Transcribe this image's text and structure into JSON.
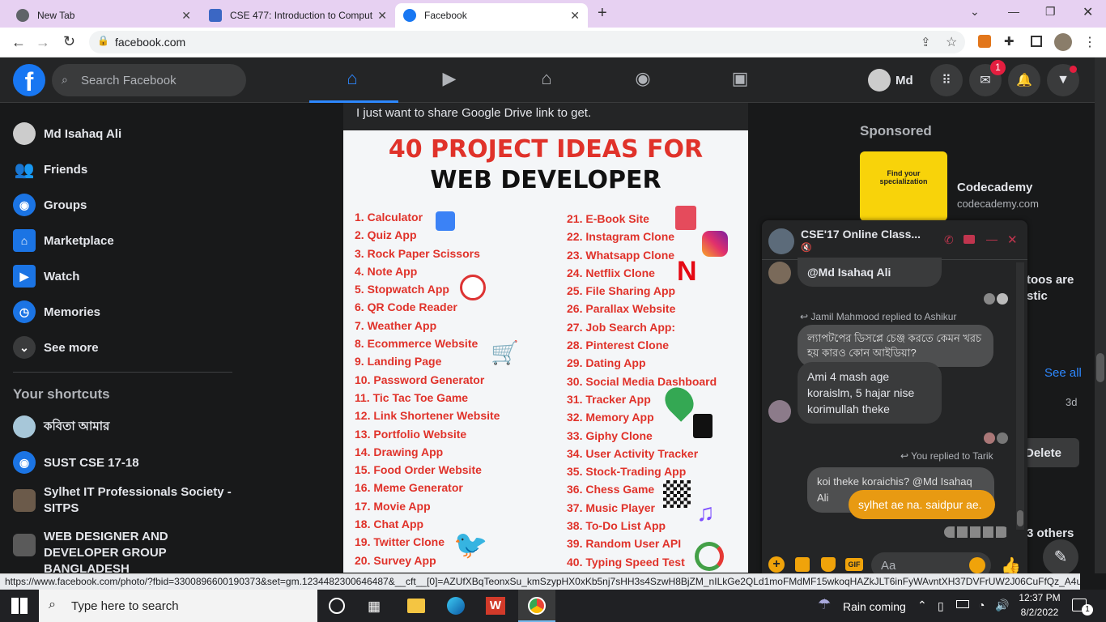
{
  "browser": {
    "tabs": [
      {
        "label": "New Tab"
      },
      {
        "label": "CSE 477: Introduction to Comput"
      },
      {
        "label": "Facebook"
      }
    ],
    "url": "facebook.com"
  },
  "header": {
    "search_placeholder": "Search Facebook",
    "profile_name": "Md",
    "messenger_badge": "1"
  },
  "sidebar": {
    "items": [
      {
        "label": "Md Isahaq Ali"
      },
      {
        "label": "Friends"
      },
      {
        "label": "Groups"
      },
      {
        "label": "Marketplace"
      },
      {
        "label": "Watch"
      },
      {
        "label": "Memories"
      },
      {
        "label": "See more"
      }
    ],
    "shortcuts_title": "Your shortcuts",
    "shortcuts": [
      {
        "label": "কবিতা আমার"
      },
      {
        "label": "SUST CSE 17-18"
      },
      {
        "label": "Sylhet IT Professionals Society - SITPS"
      },
      {
        "label": "WEB DESIGNER AND DEVELOPER GROUP BANGLADESH"
      }
    ]
  },
  "post": {
    "text": "I just want to share Google Drive link to get.",
    "image_title_1": "40 PROJECT IDEAS FOR",
    "image_title_2": "WEB DEVELOPER",
    "left_list": [
      "1. Calculator",
      "2. Quiz App",
      "3. Rock Paper Scissors",
      "4. Note App",
      "5. Stopwatch App",
      "6. QR Code Reader",
      "7. Weather App",
      "8. Ecommerce Website",
      "9. Landing Page",
      "10. Password Generator",
      "11. Tic Tac Toe Game",
      "12. Link Shortener Website",
      "13. Portfolio Website",
      "14. Drawing App",
      "15. Food Order Website",
      "16. Meme Generator",
      "17. Movie App",
      "18. Chat App",
      "19. Twitter Clone",
      "20. Survey App"
    ],
    "right_list": [
      "21. E-Book Site",
      "22. Instagram Clone",
      "23. Whatsapp Clone",
      "24. Netflix Clone",
      "25. File Sharing App",
      "26. Parallax Website",
      "27. Job Search App:",
      "28. Pinterest Clone",
      "29. Dating App",
      "30. Social Media Dashboard",
      "31. Tracker App",
      "32. Memory App",
      "33. Giphy Clone",
      "34. User Activity Tracker",
      "35. Stock-Trading App",
      "36. Chess Game",
      "37. Music Player",
      "38. To-Do List App",
      "39. Random User API",
      "40. Typing Speed Test"
    ]
  },
  "right": {
    "sponsored_title": "Sponsored",
    "ad_name": "Codecademy",
    "ad_domain": "codecademy.com",
    "ad_image_text_1": "Find your",
    "ad_image_text_2": "specialization",
    "partial_text_1": "toos are",
    "partial_text_2": "stic",
    "see_all": "See all",
    "time": "3d",
    "delete": "Delete",
    "others": "3 others"
  },
  "chat": {
    "title": "CSE'17 Online Class...",
    "messages": [
      {
        "text": "@Md Isahaq Ali"
      },
      {
        "text": "Jamil Mahmood replied to Ashikur"
      },
      {
        "text": "ল্যাপটপের ডিসপ্লে চেঞ্জ করতে কেমন খরচ হয় কারও কোন আইডিয়া?"
      },
      {
        "text": "Ami 4 mash age koraislm, 5 hajar nise korimullah theke"
      },
      {
        "text": "You replied to Tarik"
      },
      {
        "text": "koi theke koraichis? @Md Isahaq Ali"
      },
      {
        "text": "sylhet ae na. saidpur ae."
      }
    ],
    "input_placeholder": "Aa"
  },
  "status_bar": {
    "url": "https://www.facebook.com/photo/?fbid=3300896600190373&set=gm.1234482300646487&__cft__[0]=AZUfXBqTeonxSu_kmSzypHX0xKb5nj7sHH3s4SzwH8BjZM_nILkGe2QLd1moFMdMF15wkoqHAZkJLT6inFyWAvntXH37DVFrUW2J06CuFfQz_A4ubz8..."
  },
  "taskbar": {
    "search_placeholder": "Type here to search",
    "weather": "Rain coming",
    "time": "12:37 PM",
    "date": "8/2/2022",
    "notif_count": "1"
  },
  "colors": {
    "fb_blue": "#1877f2",
    "chat_orange": "#e89a12",
    "bg_dark": "#18191a"
  }
}
